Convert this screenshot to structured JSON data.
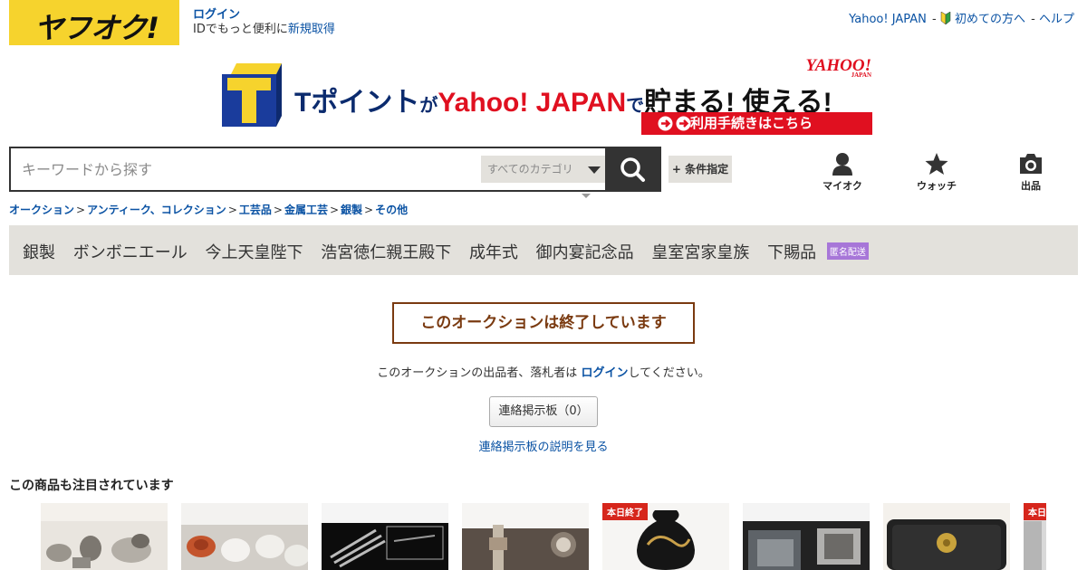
{
  "header": {
    "logo_text": "ヤフオク!",
    "login_label": "ログイン",
    "id_line_prefix": "IDでもっと便利に",
    "signup_label": "新規取得",
    "links": {
      "yahoo": "Yahoo! JAPAN",
      "sep1": "-",
      "beginner": "初めての方へ",
      "sep2": "-",
      "help": "ヘルプ"
    }
  },
  "banner": {
    "t_point": "Tポイント",
    "ga": "が",
    "yahoo_japan": "Yahoo! JAPAN",
    "de": "で",
    "slogan": "貯まる! 使える!",
    "badge_main": "YAHOO!",
    "badge_sub": "JAPAN",
    "cta": "利用手続きはこちら"
  },
  "search": {
    "placeholder": "キーワードから探す",
    "category": "すべてのカテゴリ",
    "conditions": "+ 条件指定"
  },
  "nav": {
    "myauction": "マイオク",
    "watch": "ウォッチ",
    "sell": "出品"
  },
  "breadcrumb": [
    "オークション",
    "アンティーク、コレクション",
    "工芸品",
    "金属工芸",
    "銀製",
    "その他"
  ],
  "tags": [
    "銀製",
    "ボンボニエール",
    "今上天皇陛下",
    "浩宮徳仁親王殿下",
    "成年式",
    "御内宴記念品",
    "皇室宮家皇族",
    "下賜品"
  ],
  "tags_badge": "匿名配送",
  "ended": {
    "title": "このオークションは終了しています",
    "msg_before": "このオークションの出品者、落札者は",
    "msg_link": "ログイン",
    "msg_after": "してください。",
    "board_button": "連絡掲示板（0）",
    "board_link": "連絡掲示板の説明を見る"
  },
  "recommend": {
    "title": "この商品も注目されています",
    "items": [
      {
        "badge": ""
      },
      {
        "badge": ""
      },
      {
        "badge": ""
      },
      {
        "badge": ""
      },
      {
        "badge": "本日終了"
      },
      {
        "badge": ""
      },
      {
        "badge": ""
      },
      {
        "badge": "本日終了"
      }
    ]
  },
  "colors": {
    "brand_yellow": "#f6d32d",
    "link_blue": "#0b53a4",
    "ended_brown": "#7a3a10",
    "alert_red": "#d6261c"
  }
}
